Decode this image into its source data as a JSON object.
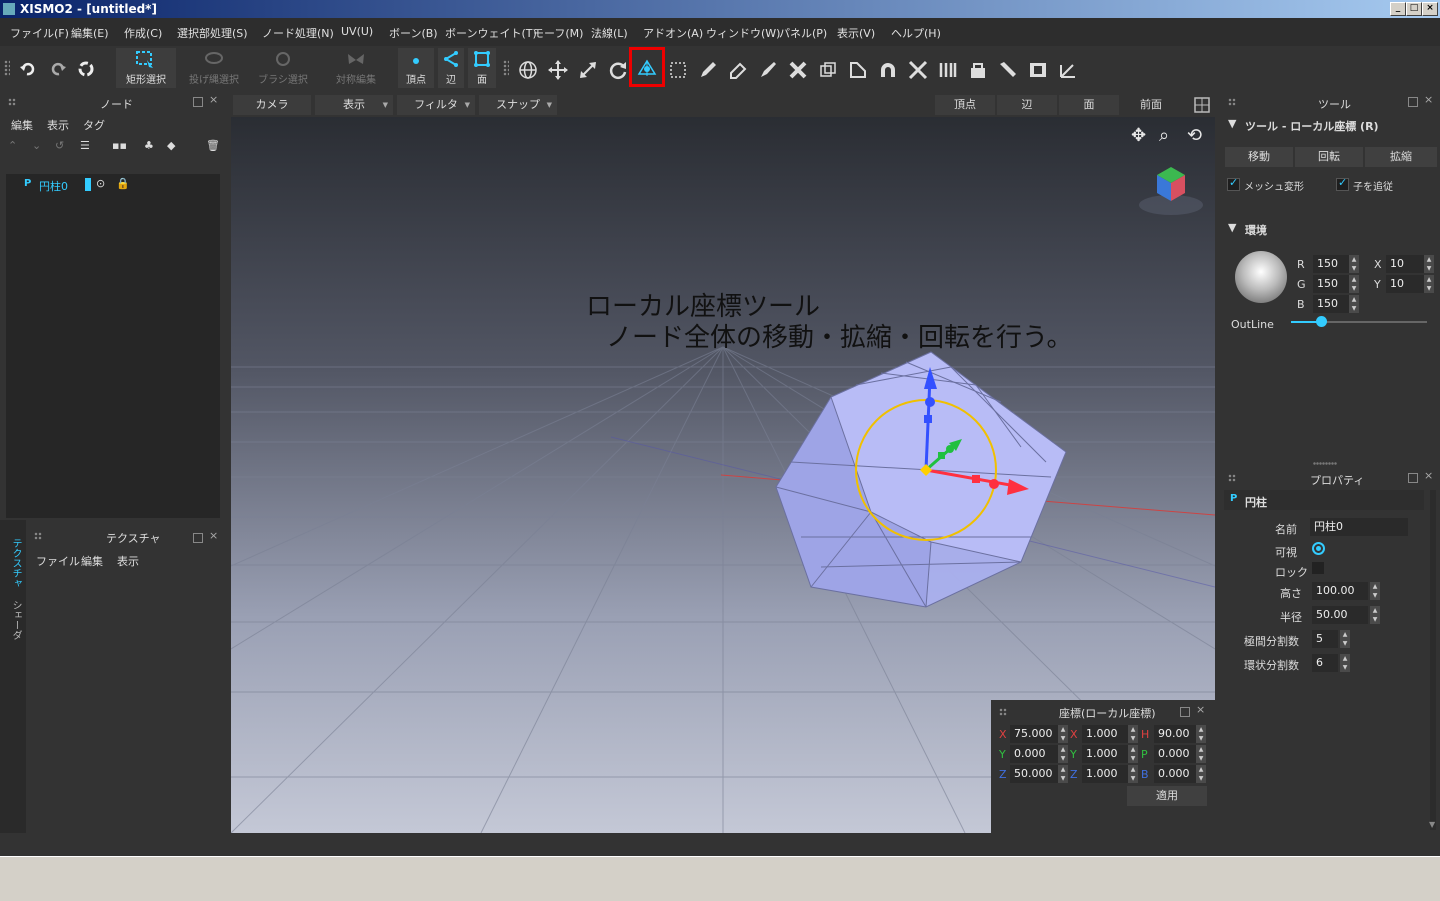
{
  "window": {
    "title": "XISMO2 - [untitled*]"
  },
  "menu": [
    "ファイル(F)",
    "編集(E)",
    "作成(C)",
    "選択部処理(S)",
    "ノード処理(N)",
    "UV(U)",
    "ボーン(B)",
    "ボーンウェイト(T)",
    "モーフ(M)",
    "法線(L)",
    "アドオン(A)",
    "ウィンドウ(W)",
    "パネル(P)",
    "表示(V)",
    "ヘルプ(H)"
  ],
  "toolbar": {
    "rect_select": "矩形選択",
    "lasso_select": "投げ縄選択",
    "brush_select": "ブラシ選択",
    "symmetric_edit": "対称編集",
    "vertex": "頂点",
    "edge": "辺",
    "face": "面"
  },
  "node_panel": {
    "title": "ノード",
    "menu": [
      "編集",
      "表示",
      "タグ"
    ],
    "items": [
      {
        "name": "円柱0"
      }
    ]
  },
  "texture_panel": {
    "title": "テクスチャ",
    "menu": [
      "ファイル",
      "編集",
      "表示"
    ],
    "side_tabs": [
      "テクスチャ",
      "シェーダ"
    ]
  },
  "view_tabs": {
    "camera": "カメラ",
    "display": "表示",
    "filter": "フィルタ",
    "snap": "スナップ",
    "vertex": "頂点",
    "edge": "辺",
    "face": "面",
    "front": "前面"
  },
  "annotation": {
    "line1": "ローカル座標ツール",
    "line2": "ノード全体の移動・拡縮・回転を行う。"
  },
  "tool_panel": {
    "title": "ツール",
    "subtitle": "ツール - ローカル座標 (R)",
    "buttons": [
      "移動",
      "回転",
      "拡縮"
    ],
    "mesh_deform": "メッシュ変形",
    "follow_child": "子を追従",
    "env_title": "環境",
    "r_label": "R",
    "r": "150",
    "g_label": "G",
    "g": "150",
    "b_label": "B",
    "b": "150",
    "x_label": "X",
    "x": "10",
    "y_label": "Y",
    "y": "10",
    "outline_label": "OutLine",
    "outline_level": 0.22
  },
  "property_panel": {
    "title": "プロパティ",
    "object": "円柱",
    "name_label": "名前",
    "name": "円柱0",
    "visible_label": "可視",
    "lock_label": "ロック",
    "height_label": "高さ",
    "height": "100.00",
    "radius_label": "半径",
    "radius": "50.00",
    "seg_v_label": "極間分割数",
    "seg_v": "5",
    "seg_r_label": "環状分割数",
    "seg_r": "6"
  },
  "coord_panel": {
    "title": "座標(ローカル座標)",
    "pos_x_label": "X",
    "pos_x": "75.000",
    "pos_y_label": "Y",
    "pos_y": "0.000",
    "pos_z_label": "Z",
    "pos_z": "50.000",
    "scl_x_label": "X",
    "scl_x": "1.000",
    "scl_y_label": "Y",
    "scl_y": "1.000",
    "scl_z_label": "Z",
    "scl_z": "1.000",
    "rot_h_label": "H",
    "rot_h": "90.00",
    "rot_p_label": "P",
    "rot_p": "0.000",
    "rot_b_label": "B",
    "rot_b": "0.000",
    "apply": "適用"
  },
  "colors": {
    "accent": "#00c8ff",
    "highlight": "#e00000",
    "gizmo_ring": "#f0c000"
  }
}
